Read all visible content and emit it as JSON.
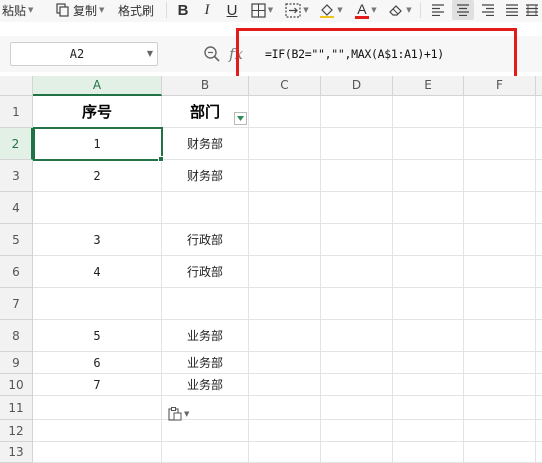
{
  "toolbar": {
    "paste_label": "粘贴",
    "copy_label": "复制",
    "format_painter_label": "格式刷",
    "bold_label": "B",
    "italic_label": "I",
    "underline_label": "U",
    "font_color_label": "A"
  },
  "formula_bar": {
    "name_box": "A2",
    "fx_label": "fx",
    "formula": "=IF(B2=\"\",\"\",MAX(A$1:A1)+1)"
  },
  "columns": [
    "A",
    "B",
    "C",
    "D",
    "E",
    "F"
  ],
  "rows": [
    "1",
    "2",
    "3",
    "4",
    "5",
    "6",
    "7",
    "8",
    "9",
    "10",
    "11",
    "12",
    "13"
  ],
  "cells": {
    "a1": "序号",
    "b1": "部门",
    "a2": "1",
    "b2": "财务部",
    "a3": "2",
    "b3": "财务部",
    "a5": "3",
    "b5": "行政部",
    "a6": "4",
    "b6": "行政部",
    "a8": "5",
    "b8": "业务部",
    "a9": "6",
    "b9": "业务部",
    "a10": "7",
    "b10": "业务部"
  },
  "colors": {
    "accent_green": "#217346",
    "highlight_red": "#e31b1b",
    "font_color_bar": "#e31b1b"
  }
}
